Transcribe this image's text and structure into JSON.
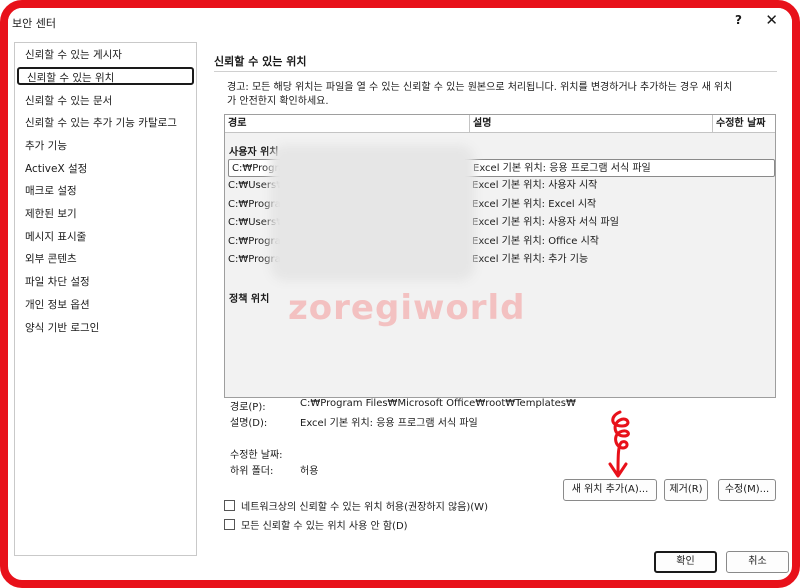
{
  "window": {
    "title": "보안 센터",
    "help_label": "?",
    "close_label": "✕"
  },
  "sidebar": {
    "items": [
      {
        "label": "신뢰할 수 있는 게시자"
      },
      {
        "label": "신뢰할 수 있는 위치",
        "selected": true
      },
      {
        "label": "신뢰할 수 있는 문서"
      },
      {
        "label": "신뢰할 수 있는 추가 기능 카탈로그"
      },
      {
        "label": "추가 기능"
      },
      {
        "label": "ActiveX 설정"
      },
      {
        "label": "매크로 설정"
      },
      {
        "label": "제한된 보기"
      },
      {
        "label": "메시지 표시줄"
      },
      {
        "label": "외부 콘텐츠"
      },
      {
        "label": "파일 차단 설정"
      },
      {
        "label": "개인 정보 옵션"
      },
      {
        "label": "양식 기반 로그인"
      }
    ]
  },
  "main": {
    "section_title": "신뢰할 수 있는 위치",
    "warning_line1": "경고: 모든 해당 위치는 파일을 열 수 있는 신뢰할 수 있는 원본으로 처리됩니다. 위치를 변경하거나 추가하는 경우 새 위치",
    "warning_line2": "가 안전한지 확인하세요."
  },
  "locations_table": {
    "columns": {
      "path": "경로",
      "description": "설명",
      "modified": "수정한 날짜"
    },
    "groups": {
      "user": "사용자 위치",
      "policy": "정책 위치"
    },
    "rows": [
      {
        "path": "C:₩Progra",
        "description": "Excel 기본 위치: 응용 프로그램 서식 파일",
        "selected": true
      },
      {
        "path": "C:₩Users₩",
        "description": "Excel 기본 위치: 사용자 시작"
      },
      {
        "path": "C:₩Progra",
        "description": "Excel 기본 위치: Excel 시작"
      },
      {
        "path": "C:₩Users₩",
        "description": "Excel 기본 위치: 사용자 서식 파일"
      },
      {
        "path": "C:₩Progra",
        "description": "Excel 기본 위치: Office 시작"
      },
      {
        "path": "C:₩Progra",
        "description": "Excel 기본 위치: 추가 기능"
      }
    ],
    "watermark": "zoregiworld"
  },
  "details": {
    "path_label": "경로(P):",
    "path_value": "C:₩Program Files₩Microsoft Office₩root₩Templates₩",
    "desc_label": "설명(D):",
    "desc_value": "Excel 기본 위치: 응용 프로그램 서식 파일",
    "modified_label": "수정한 날짜:",
    "modified_value": "",
    "subfolders_label": "하위 폴더:",
    "subfolders_value": "허용"
  },
  "buttons": {
    "add_location": "새 위치 추가(A)...",
    "remove": "제거(R)",
    "modify": "수정(M)...",
    "ok": "확인",
    "cancel": "취소"
  },
  "options": {
    "allow_network": "네트워크상의 신뢰할 수 있는 위치 허용(권장하지 않음)(W)",
    "disable_all": "모든 신뢰할 수 있는 위치 사용 안 함(D)",
    "allow_network_checked": false,
    "disable_all_checked": false
  },
  "colors": {
    "frame": "#e8111a",
    "annotation": "#e8111a"
  }
}
